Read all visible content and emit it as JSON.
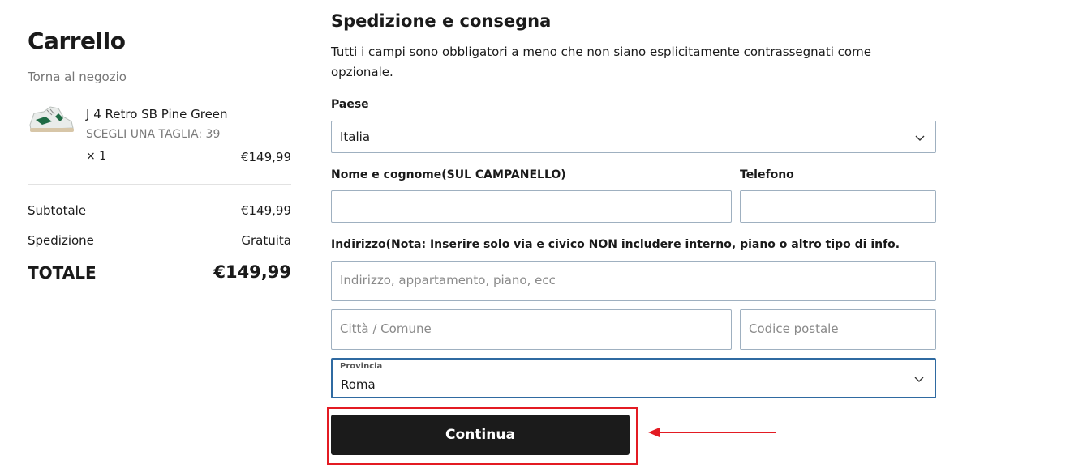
{
  "cart": {
    "title": "Carrello",
    "back_link": "Torna al negozio",
    "item": {
      "name": "J 4 Retro SB Pine Green",
      "variant": "SCEGLI UNA TAGLIA: 39",
      "quantity": "× 1",
      "price": "€149,99"
    },
    "subtotal_label": "Subtotale",
    "subtotal_value": "€149,99",
    "shipping_label": "Spedizione",
    "shipping_value": "Gratuita",
    "total_label": "TOTALE",
    "total_value": "€149,99"
  },
  "form": {
    "title": "Spedizione e consegna",
    "description": "Tutti i campi sono obbligatori a meno che non siano esplicitamente contrassegnati come opzionale.",
    "country_label": "Paese",
    "country_value": "Italia",
    "name_label": "Nome e cognome(SUL CAMPANELLO)",
    "name_value": "",
    "phone_label": "Telefono",
    "phone_value": "",
    "address_label": "Indirizzo(Nota: Inserire solo via e civico NON includere interno, piano o altro tipo di info.",
    "address_placeholder": "Indirizzo, appartamento, piano, ecc",
    "city_placeholder": "Città / Comune",
    "postal_placeholder": "Codice postale",
    "province_label": "Provincia",
    "province_value": "Roma",
    "continue_label": "Continua"
  },
  "colors": {
    "button_bg": "#1b1b1b",
    "highlight": "#e31b23",
    "focus_border": "#2f6aa1"
  },
  "icons": {
    "select_chevron": "chevron-down-icon",
    "annotation_arrow": "arrow-left-icon"
  }
}
